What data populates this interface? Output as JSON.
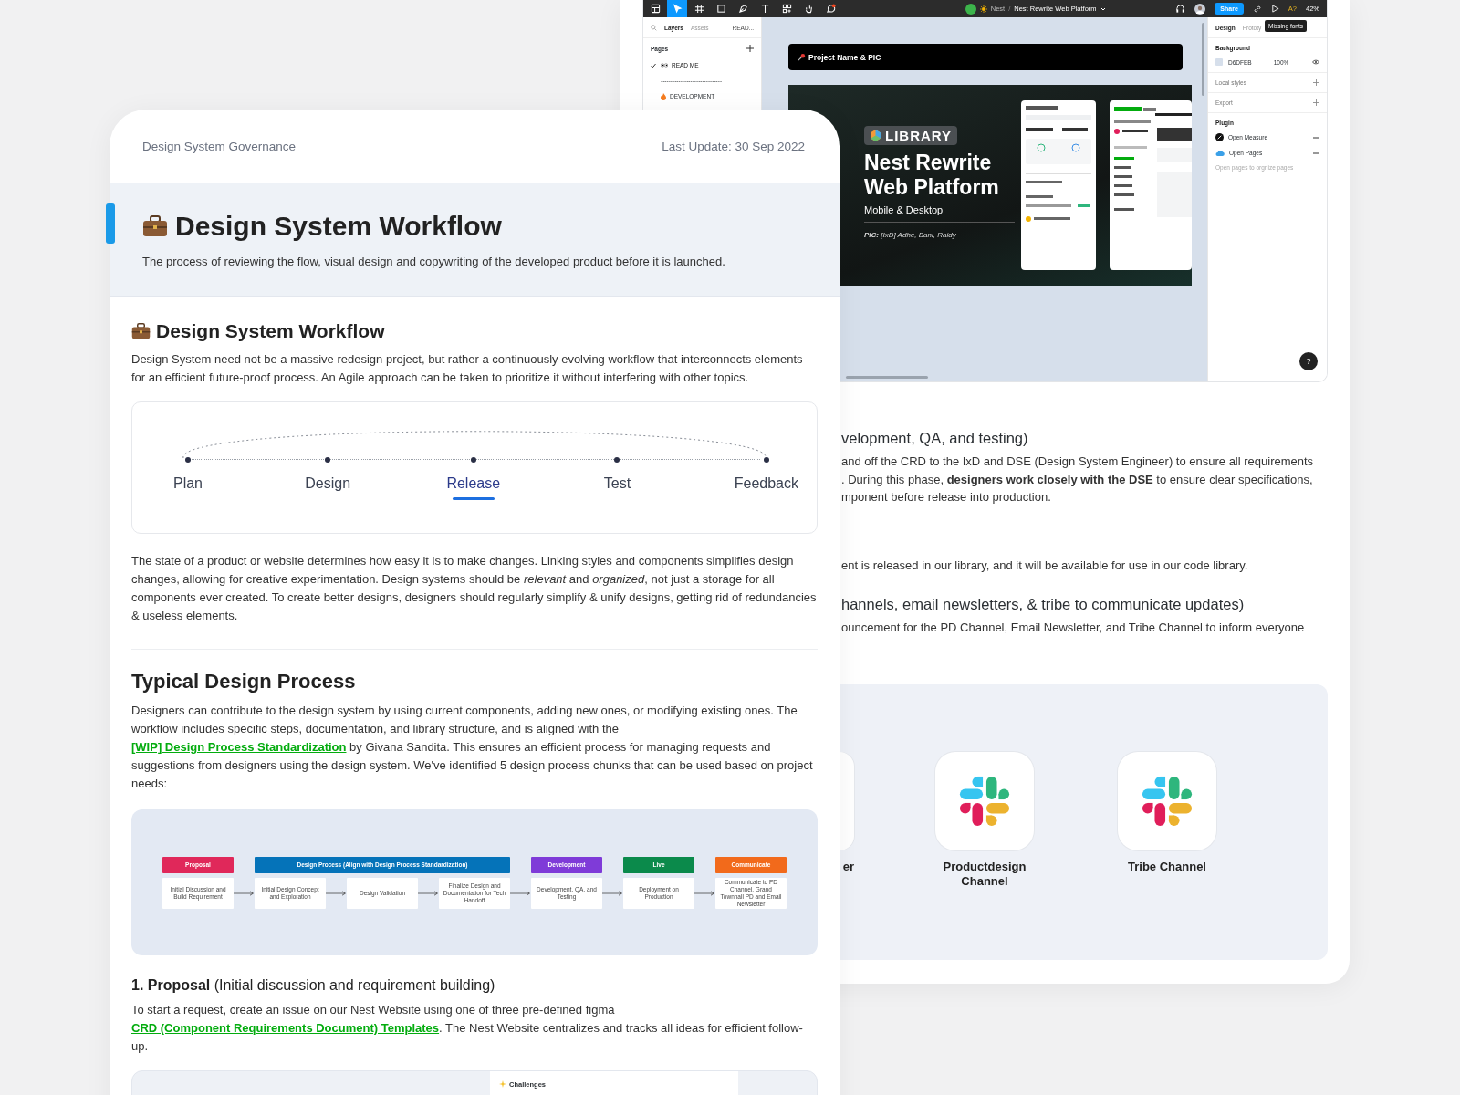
{
  "figma": {
    "toolbar": {
      "tools": [
        {
          "kind": "menu",
          "selected": false
        },
        {
          "kind": "move",
          "selected": true
        },
        {
          "kind": "frame",
          "selected": false
        },
        {
          "kind": "shape",
          "selected": false
        },
        {
          "kind": "pen",
          "selected": false
        },
        {
          "kind": "text",
          "selected": false
        },
        {
          "kind": "resources",
          "selected": false
        },
        {
          "kind": "hand",
          "selected": false
        },
        {
          "kind": "comment",
          "selected": false
        }
      ],
      "team": "Nest",
      "separator": "/",
      "file": "Nest Rewrite Web Platform",
      "share": "Share",
      "font_warning": "A?",
      "zoom": "42%",
      "tooltip": "Missing fonts"
    },
    "left_panel": {
      "tabs": [
        {
          "label": "Layers",
          "selected": true
        },
        {
          "label": "Assets",
          "selected": false
        }
      ],
      "page_menu": "READ...",
      "pages_title": "Pages",
      "pages": [
        {
          "kind": "eyes",
          "label": "READ ME",
          "selected": true
        },
        {
          "kind": "separator",
          "label": "-------------------------------",
          "selected": false
        },
        {
          "kind": "fire",
          "label": "DEVELOPMENT",
          "selected": false
        }
      ]
    },
    "canvas": {
      "banner": "Project Name & PIC",
      "badge": "LIBRARY",
      "title": "Nest Rewrite Web Platform",
      "subtitle": "Mobile & Desktop",
      "pic": "**PIC:** [IxD] Adhe, Bani, Raidy"
    },
    "right_panel": {
      "tabs": [
        {
          "label": "Design",
          "selected": true
        },
        {
          "label": "Prototy",
          "selected": false
        }
      ],
      "background_title": "Background",
      "swatch_hex": "D6DFEB",
      "opacity": "100%",
      "local_styles": "Local styles",
      "export": "Export",
      "plugin_title": "Plugin",
      "plugins": [
        {
          "kind": "measure",
          "label": "Open Measure"
        },
        {
          "kind": "pages",
          "label": "Open Pages"
        }
      ],
      "plugin_hint": "Open pages to orgnize pages",
      "help": "?"
    }
  },
  "back_doc": {
    "blocks": [
      {
        "kind": "heading",
        "text": "velopment, QA, and testing)"
      },
      {
        "kind": "line",
        "text": "and off the CRD to the IxD and DSE (Design System Engineer) to ensure all requirements"
      },
      {
        "kind": "line",
        "text": ". During this phase, **designers work closely with the DSE** to ensure clear specifications,"
      },
      {
        "kind": "line",
        "text": "mponent before release into production."
      },
      {
        "kind": "spaced_line",
        "text": "ent is released in our library, and it will be available for use in our code library."
      },
      {
        "kind": "heading",
        "text": "hannels, email newsletters, & tribe to communicate updates)"
      },
      {
        "kind": "line",
        "text": "ouncement for the PD Channel, Email Newsletter, and Tribe Channel to inform everyone"
      }
    ],
    "channels": [
      {
        "kind": "cut",
        "label": "er"
      },
      {
        "kind": "tile",
        "label": "Productdesign Channel"
      },
      {
        "kind": "tile",
        "label": "Tribe Channel"
      }
    ]
  },
  "doc": {
    "header_left": "Design System Governance",
    "header_right": "Last Update: 30 Sep 2022",
    "hero_title": "Design System Workflow",
    "hero_subtitle": "The process of reviewing the flow, visual design and copywriting of the developed product before it is launched.",
    "section_title": "Design System Workflow",
    "intro": "Design System need not be a massive redesign project, but rather a continuously evolving workflow that interconnects elements for an efficient future-proof process. An Agile approach can be taken to prioritize it without interfering with other topics.",
    "cycle": [
      {
        "label": "Plan",
        "selected": false
      },
      {
        "label": "Design",
        "selected": false
      },
      {
        "label": "Release",
        "selected": true
      },
      {
        "label": "Test",
        "selected": false
      },
      {
        "label": "Feedback",
        "selected": false
      }
    ],
    "state_text": "The state of a product or website determines how easy it is to make changes. Linking styles and components simplifies design changes, allowing for creative experimentation. Design systems should be *relevant* and *organized*, not just a storage for all components ever created. To create better designs, designers should regularly simplify & unify designs, getting rid of redundancies & useless elements.",
    "process_title": "Typical Design Process",
    "process_text": [
      {
        "kind": "text",
        "text": "Designers can contribute to the design system by using current components, adding new ones, or modifying existing ones. The workflow includes specific steps, documentation, and library structure, and is aligned with the "
      },
      {
        "kind": "link",
        "text": "[WIP] Design Process Standardization"
      },
      {
        "kind": "text",
        "text": " by Givana Sandita. This ensures an efficient process for managing requests and suggestions from designers using the design system. We've identified 5 design process chunks that can be used based on project needs:"
      }
    ],
    "phases": [
      {
        "label": "Proposal",
        "color": "#e0285a",
        "steps": [
          "Initial Discussion and Build Requirement"
        ]
      },
      {
        "label": "Design Process (Align with Design Process Standardization)",
        "color": "#0573b9",
        "steps": [
          "Initial Design Concept and Exploration",
          "Design Validation",
          "Finalize Design and Documentation for Tech Handoff"
        ]
      },
      {
        "label": "Development",
        "color": "#7f3bd8",
        "steps": [
          "Development, QA, and Testing"
        ]
      },
      {
        "label": "Live",
        "color": "#0b8a4b",
        "steps": [
          "Deployment on Production"
        ]
      },
      {
        "label": "Communicate",
        "color": "#f26a1b",
        "steps": [
          "Communicate to PD Channel, Grand Townhall PD and Email Newsletter"
        ]
      }
    ],
    "proposal_title": "**1. Proposal** (Initial discussion and requirement building)",
    "proposal_text": [
      {
        "kind": "text",
        "text": "To start a request, create an issue on our Nest Website using one of three pre-defined figma "
      },
      {
        "kind": "link",
        "text": "CRD (Component Requirements Document) Templates"
      },
      {
        "kind": "text",
        "text": ". The Nest Website centralizes and tracks all ideas for efficient follow-up."
      }
    ],
    "challenges": "Challenges"
  }
}
